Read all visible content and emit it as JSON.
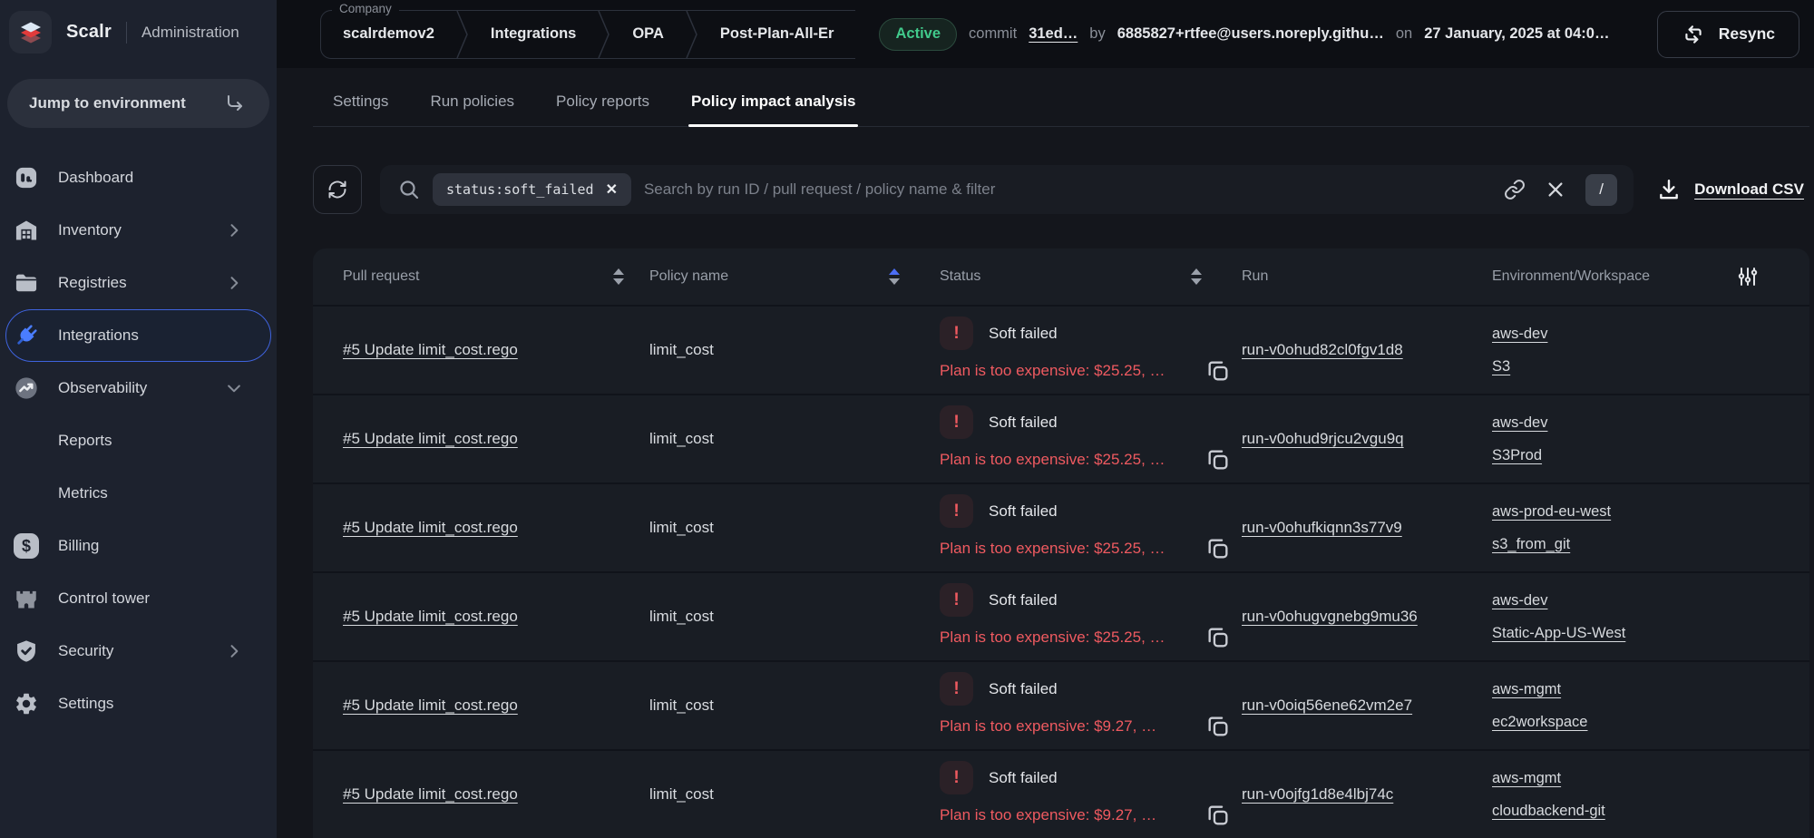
{
  "colors": {
    "accent_blue": "#3f63dd",
    "status_red": "#ef5a60",
    "active_green": "#41c98b",
    "sidebar_bg": "#1d222e",
    "topbar_bg": "#0d0f14",
    "table_bg": "#191d24"
  },
  "sidebar": {
    "logo_title": "Scalr",
    "logo_subtitle": "Administration",
    "jump_button": "Jump to environment",
    "items": [
      {
        "label": "Dashboard"
      },
      {
        "label": "Inventory"
      },
      {
        "label": "Registries"
      },
      {
        "label": "Integrations"
      },
      {
        "label": "Observability"
      },
      {
        "label": "Reports"
      },
      {
        "label": "Metrics"
      },
      {
        "label": "Billing"
      },
      {
        "label": "Control tower"
      },
      {
        "label": "Security"
      },
      {
        "label": "Settings"
      }
    ]
  },
  "topbar": {
    "breadcrumb_label": "Company",
    "breadcrumbs": [
      "scalrdemov2",
      "Integrations",
      "OPA",
      "Post-Plan-All-Er"
    ],
    "status_badge": "Active",
    "commit_label": "commit",
    "commit_value": "31ed…",
    "by_label": "by",
    "author": "6885827+rtfee@users.noreply.githu…",
    "on_label": "on",
    "date": "27 January, 2025 at 04:0…",
    "resync_label": "Resync"
  },
  "tabs": [
    {
      "label": "Settings"
    },
    {
      "label": "Run policies"
    },
    {
      "label": "Policy reports"
    },
    {
      "label": "Policy impact analysis"
    }
  ],
  "toolbar": {
    "filter_chip": "status:soft_failed",
    "search_placeholder": "Search by run ID / pull request / policy name & filter",
    "slash_key": "/",
    "download_label": "Download CSV"
  },
  "table": {
    "columns": [
      "Pull request",
      "Policy name",
      "Status",
      "Run",
      "Environment/Workspace"
    ],
    "rows": [
      {
        "pull_request": "#5 Update limit_cost.rego",
        "policy_name": "limit_cost",
        "status": "Soft failed",
        "message": "Plan is too expensive: $25.25, …",
        "run": "run-v0ohud82cl0fgv1d8",
        "environment": "aws-dev",
        "workspace": "S3"
      },
      {
        "pull_request": "#5 Update limit_cost.rego",
        "policy_name": "limit_cost",
        "status": "Soft failed",
        "message": "Plan is too expensive: $25.25, …",
        "run": "run-v0ohud9rjcu2vgu9q",
        "environment": "aws-dev",
        "workspace": "S3Prod"
      },
      {
        "pull_request": "#5 Update limit_cost.rego",
        "policy_name": "limit_cost",
        "status": "Soft failed",
        "message": "Plan is too expensive: $25.25, …",
        "run": "run-v0ohufkiqnn3s77v9",
        "environment": "aws-prod-eu-west",
        "workspace": "s3_from_git"
      },
      {
        "pull_request": "#5 Update limit_cost.rego",
        "policy_name": "limit_cost",
        "status": "Soft failed",
        "message": "Plan is too expensive: $25.25, …",
        "run": "run-v0ohugvgnebg9mu36",
        "environment": "aws-dev",
        "workspace": "Static-App-US-West"
      },
      {
        "pull_request": "#5 Update limit_cost.rego",
        "policy_name": "limit_cost",
        "status": "Soft failed",
        "message": "Plan is too expensive: $9.27, …",
        "run": "run-v0oiq56ene62vm2e7",
        "environment": "aws-mgmt",
        "workspace": "ec2workspace"
      },
      {
        "pull_request": "#5 Update limit_cost.rego",
        "policy_name": "limit_cost",
        "status": "Soft failed",
        "message": "Plan is too expensive: $9.27, …",
        "run": "run-v0ojfg1d8e4lbj74c",
        "environment": "aws-mgmt",
        "workspace": "cloudbackend-git"
      }
    ]
  }
}
